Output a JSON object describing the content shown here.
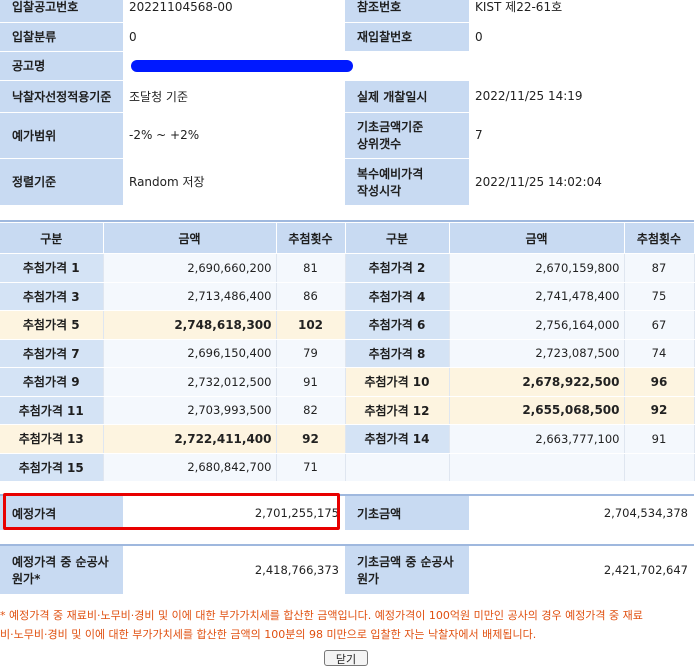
{
  "info": {
    "rows": [
      {
        "l1": "입찰공고번호",
        "v1": "20221104568-00",
        "l2": "참조번호",
        "v2": "KIST 제22-61호"
      },
      {
        "l1": "입찰분류",
        "v1": "0",
        "l2": "재입찰번호",
        "v2": "0"
      },
      {
        "l1": "공고명",
        "v1": ""
      },
      {
        "l1": "낙찰자선정적용기준",
        "v1": "조달청 기준",
        "l2": "실제 개찰일시",
        "v2": "2022/11/25 14:19"
      },
      {
        "l1": "예가범위",
        "v1": "-2% ~ +2%",
        "l2a": "기초금액기준",
        "l2b": "상위갯수",
        "v2": "7"
      },
      {
        "l1": "정렬기준",
        "v1": "Random 저장",
        "l2a": "복수예비가격",
        "l2b": "작성시각",
        "v2": "2022/11/25 14:02:04"
      }
    ]
  },
  "draw": {
    "headers": {
      "g": "구분",
      "a": "금액",
      "c": "추첨횟수"
    },
    "rows": [
      {
        "l1": "추첨가격 1",
        "a1": "2,690,660,200",
        "c1": "81",
        "l2": "추첨가격 2",
        "a2": "2,670,159,800",
        "c2": "87"
      },
      {
        "l1": "추첨가격 3",
        "a1": "2,713,486,400",
        "c1": "86",
        "l2": "추첨가격 4",
        "a2": "2,741,478,400",
        "c2": "75"
      },
      {
        "l1": "추첨가격 5",
        "a1": "2,748,618,300",
        "c1": "102",
        "l2": "추첨가격 6",
        "a2": "2,756,164,000",
        "c2": "67"
      },
      {
        "l1": "추첨가격 7",
        "a1": "2,696,150,400",
        "c1": "79",
        "l2": "추첨가격 8",
        "a2": "2,723,087,500",
        "c2": "74"
      },
      {
        "l1": "추첨가격 9",
        "a1": "2,732,012,500",
        "c1": "91",
        "l2": "추첨가격 10",
        "a2": "2,678,922,500",
        "c2": "96"
      },
      {
        "l1": "추첨가격 11",
        "a1": "2,703,993,500",
        "c1": "82",
        "l2": "추첨가격 12",
        "a2": "2,655,068,500",
        "c2": "92"
      },
      {
        "l1": "추첨가격 13",
        "a1": "2,722,411,400",
        "c1": "92",
        "l2": "추첨가격 14",
        "a2": "2,663,777,100",
        "c2": "91"
      },
      {
        "l1": "추첨가격 15",
        "a1": "2,680,842,700",
        "c1": "71",
        "l2": "",
        "a2": "",
        "c2": ""
      }
    ]
  },
  "summary": {
    "est_label": "예정가격",
    "est_value": "2,701,255,175",
    "base_label": "기초금액",
    "base_value": "2,704,534,378",
    "est_net_label_a": "예정가격 중 순공사",
    "est_net_label_b": "원가*",
    "est_net_value": "2,418,766,373",
    "base_net_label_a": "기초금액 중 순공사",
    "base_net_label_b": "원가",
    "base_net_value": "2,421,702,647"
  },
  "note": {
    "line1": "* 예정가격 중 재료비·노무비·경비 및 이에 대한 부가가치세를 합산한 금액입니다. 예정가격이 100억원 미만인 공사의 경우 예정가격 중 재료",
    "line2": "비·노무비·경비 및 이에 대한 부가가치세를 합산한 금액의 100분의 98 미만으로 입찰한 자는 낙찰자에서 배제됩니다."
  },
  "close_label": "닫기"
}
